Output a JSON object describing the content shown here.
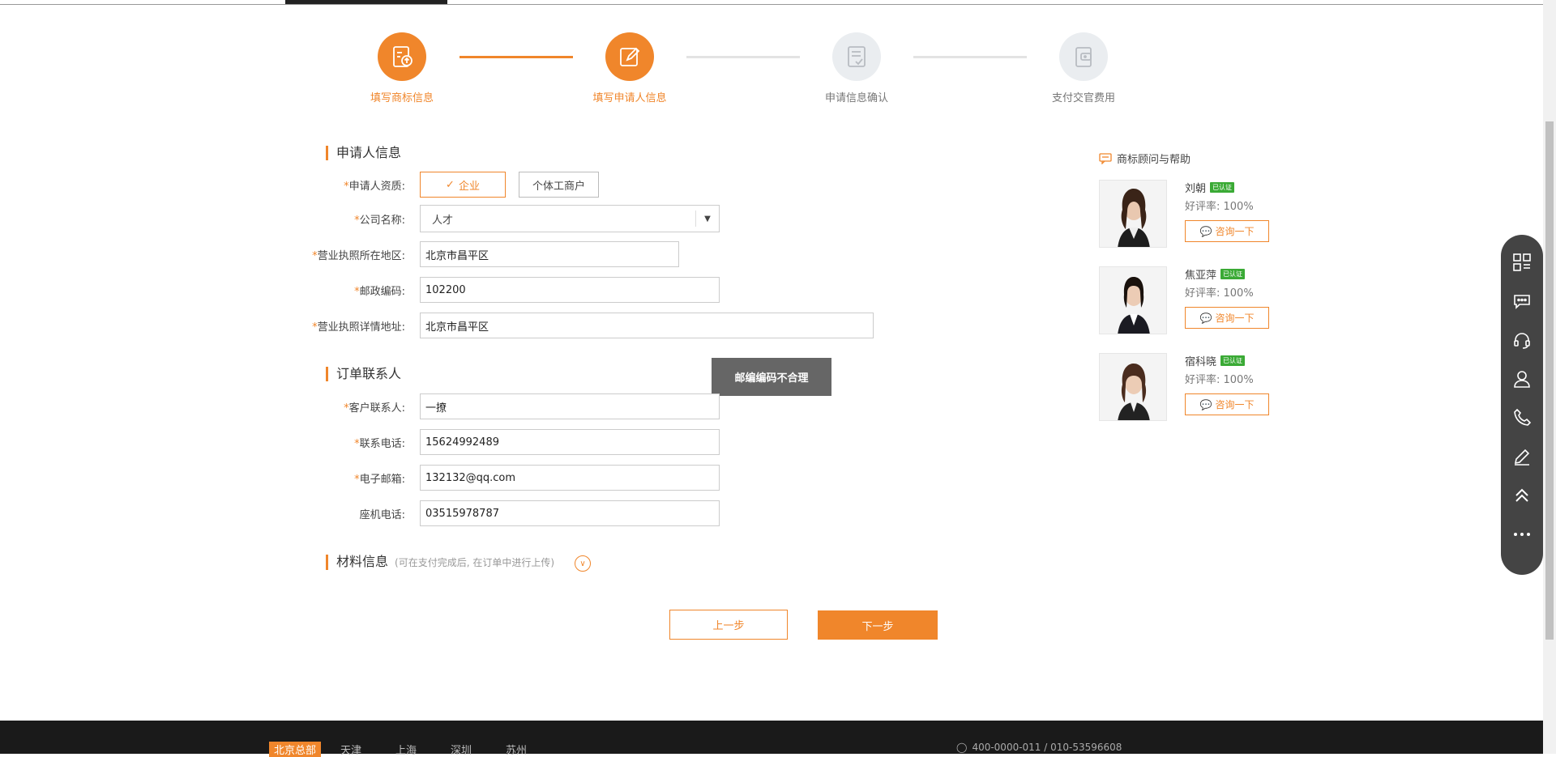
{
  "steps": [
    {
      "label": "填写商标信息",
      "state": "on",
      "icon": "document-upload-icon"
    },
    {
      "label": "填写申请人信息",
      "state": "on",
      "icon": "edit-pen-icon"
    },
    {
      "label": "申请信息确认",
      "state": "off",
      "icon": "document-check-icon"
    },
    {
      "label": "支付交官费用",
      "state": "off",
      "icon": "wallet-icon"
    }
  ],
  "applicant": {
    "section_title": "申请人信息",
    "qualification_label": "申请人资质:",
    "qual_option_company": "企业",
    "qual_option_individual": "个体工商户",
    "company_label": "公司名称:",
    "company_value": "人才",
    "region_label": "营业执照所在地区:",
    "region_value": "北京市昌平区",
    "postcode_label": "邮政编码:",
    "postcode_value": "102200",
    "address_label": "营业执照详情地址:",
    "address_value": "北京市昌平区"
  },
  "tooltip": "邮编编码不合理",
  "contact": {
    "section_title": "订单联系人",
    "name_label": "客户联系人:",
    "name_value": "一撩",
    "phone_label": "联系电话:",
    "phone_value": "15624992489",
    "email_label": "电子邮箱:",
    "email_value": "132132@qq.com",
    "landline_label": "座机电话:",
    "landline_value": "03515978787"
  },
  "materials": {
    "section_title": "材料信息",
    "hint": "(可在支付完成后, 在订单中进行上传)"
  },
  "buttons": {
    "prev": "上一步",
    "next": "下一步"
  },
  "advisors": {
    "title": "商标顾问与帮助",
    "badge": "已认证",
    "consult": "咨询一下",
    "list": [
      {
        "name": "刘朝",
        "rate": "好评率: 100%"
      },
      {
        "name": "焦亚萍",
        "rate": "好评率: 100%"
      },
      {
        "name": "宿科晓",
        "rate": "好评率: 100%"
      }
    ]
  },
  "footer": {
    "tabs": [
      "北京总部",
      "天津",
      "上海",
      "深圳",
      "苏州"
    ],
    "phone": "400-0000-011 / 010-53596608"
  },
  "sidebar_icons": [
    "qrcode-icon",
    "chat-icon",
    "headset-icon",
    "user-icon",
    "phone-icon",
    "edit-icon",
    "back-to-top-icon",
    "more-icon"
  ],
  "colors": {
    "accent": "#f0862b",
    "verified": "#3aaa35",
    "sidebar": "#444444"
  }
}
